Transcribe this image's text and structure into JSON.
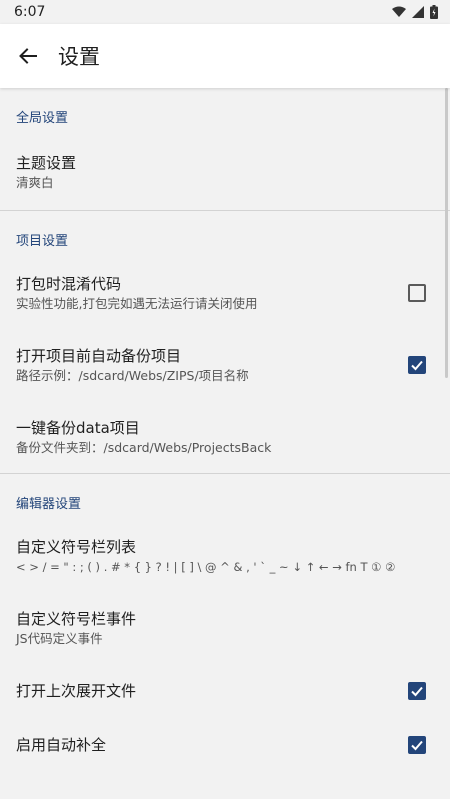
{
  "status_bar": {
    "time": "6:07"
  },
  "app_bar": {
    "title": "设置"
  },
  "sections": {
    "global": {
      "header": "全局设置",
      "theme": {
        "title": "主题设置",
        "summary": "清爽白"
      }
    },
    "project": {
      "header": "项目设置",
      "obfuscate": {
        "title": "打包时混淆代码",
        "summary": "实验性功能,打包完如遇无法运行请关闭使用",
        "checked": false
      },
      "auto_backup": {
        "title": "打开项目前自动备份项目",
        "summary": "路径示例：/sdcard/Webs/ZIPS/项目名称",
        "checked": true
      },
      "backup_data": {
        "title": "一键备份data项目",
        "summary": "备份文件夹到：/sdcard/Webs/ProjectsBack"
      }
    },
    "editor": {
      "header": "编辑器设置",
      "symbol_list": {
        "title": "自定义符号栏列表",
        "summary": "< > / = \" : ; ( ) . # * { } ? ! | [ ] \\ @ ^ & , ' ` _ ~ ↓ ↑ ← → fn T ① ②"
      },
      "symbol_events": {
        "title": "自定义符号栏事件",
        "summary": "JS代码定义事件"
      },
      "open_last": {
        "title": "打开上次展开文件",
        "checked": true
      },
      "autocomplete": {
        "title": "启用自动补全",
        "checked": true
      }
    }
  },
  "colors": {
    "accent": "#23457a",
    "background": "#f2f2f2",
    "app_bar": "#ffffff"
  }
}
